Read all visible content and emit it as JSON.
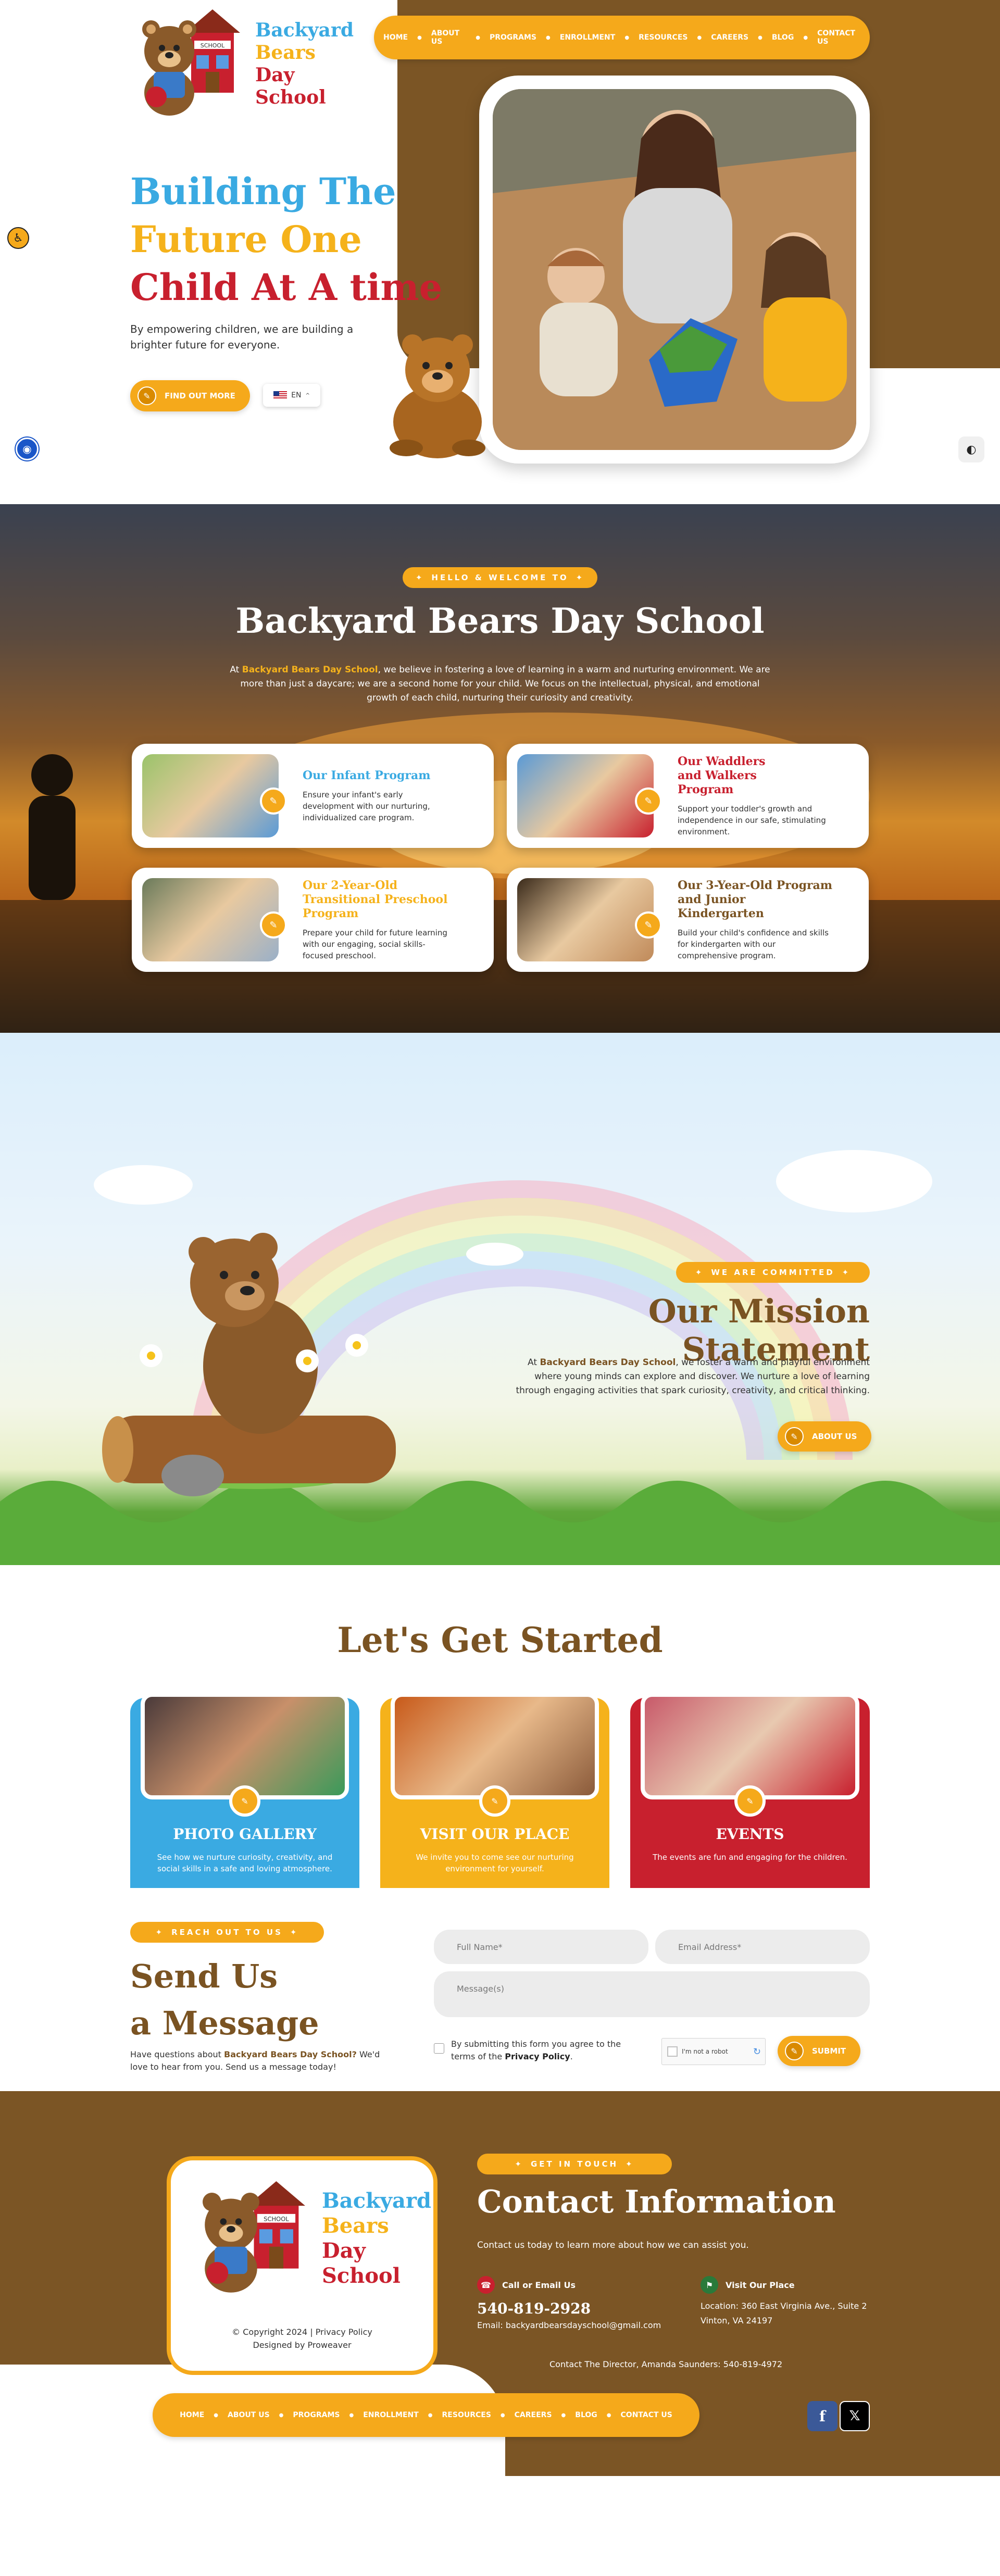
{
  "brand": {
    "line1": "Backyard",
    "line2": "Bears",
    "line3": "Day",
    "line4": "School",
    "school_sign": "SCHOOL"
  },
  "nav": {
    "items": [
      "HOME",
      "ABOUT US",
      "PROGRAMS",
      "ENROLLMENT",
      "RESOURCES",
      "CAREERS",
      "BLOG",
      "CONTACT US"
    ]
  },
  "hero": {
    "title1": "Building The",
    "title2": "Future One",
    "title3": "Child At A time",
    "subtitle": "By empowering children, we are building a brighter future for everyone.",
    "cta": "FIND OUT MORE",
    "lang": "EN"
  },
  "welcome": {
    "pill": "HELLO & WELCOME TO",
    "title": "Backyard Bears Day School",
    "intro_prefix": "At",
    "intro_brand": "Backyard Bears Day School",
    "intro_rest": ", we believe in fostering a love of learning in a warm and nurturing environment. We are more than just a daycare; we are a second home for your child. We focus on the intellectual, physical, and emotional growth of each child, nurturing their curiosity and creativity.",
    "programs": [
      {
        "title": "Our Infant Program",
        "text": "Ensure your infant's early development with our nurturing, individualized care program."
      },
      {
        "title": "Our Waddlers and Walkers Program",
        "text": "Support your toddler's growth and independence in our safe, stimulating environment."
      },
      {
        "title": "Our 2-Year-Old Transitional Preschool Program",
        "text": "Prepare your child for future learning with our engaging, social skills-focused preschool."
      },
      {
        "title": "Our 3-Year-Old Program and Junior Kindergarten",
        "text": "Build your child's confidence and skills for kindergarten with our comprehensive program."
      }
    ]
  },
  "mission": {
    "pill": "WE ARE COMMITTED",
    "title": "Our Mission Statement",
    "text_prefix": "At",
    "text_brand": "Backyard Bears Day School",
    "text_rest": ", we foster a warm and playful environment where young minds can explore and discover. We nurture a love of learning through engaging activities that spark curiosity, creativity, and critical thinking.",
    "cta": "ABOUT US"
  },
  "started": {
    "title": "Let's Get Started",
    "cards": [
      {
        "title": "PHOTO GALLERY",
        "text": "See how we nurture curiosity, creativity, and social skills in a safe and loving atmosphere.",
        "color": "#3aaae2"
      },
      {
        "title": "VISIT OUR PLACE",
        "text": "We invite you to come see our nurturing environment for yourself.",
        "color": "#f5b21b"
      },
      {
        "title": "EVENTS",
        "text": "The events are fun and engaging for the children.",
        "color": "#c8202e"
      }
    ]
  },
  "message": {
    "pill": "REACH OUT TO US",
    "title1": "Send Us",
    "title2": "a Message",
    "text_prefix": "Have questions about",
    "text_brand": "Backyard Bears Day School?",
    "text_rest": "We'd love to hear from you. Send us a message today!",
    "full_name": "Full Name*",
    "email": "Email Address*",
    "msg": "Message(s)",
    "consent_prefix": "By submitting this form you agree to the terms of the",
    "consent_link": "Privacy Policy",
    "captcha": "I'm not a robot",
    "submit": "SUBMIT"
  },
  "contact": {
    "pill": "GET IN TOUCH",
    "title": "Contact Information",
    "subtitle": "Contact us today to learn more about how we can assist you.",
    "call_label": "Call or Email Us",
    "phone": "540-819-2928",
    "email": "Email: backyardbearsdayschool@gmail.com",
    "visit_label": "Visit Our Place",
    "location": "Location: 360 East Virginia Ave., Suite 2 Vinton, VA 24197",
    "director": "Contact The Director, Amanda Saunders: 540-819-4972",
    "copyright": "© Copyright 2024",
    "privacy": "Privacy Policy",
    "designed": "Designed by Proweaver"
  },
  "colors": {
    "brown": "#7b5525",
    "orange": "#f5a91b",
    "blue": "#3aaae2",
    "red": "#c8202e"
  }
}
